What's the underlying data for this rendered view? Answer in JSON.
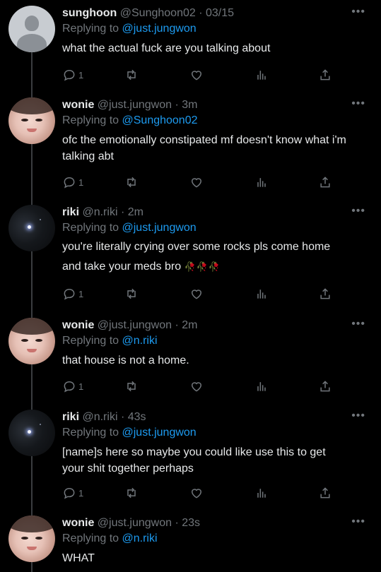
{
  "tweets": [
    {
      "name": "sunghoon",
      "handle": "@Sunghoon02",
      "sep": "·",
      "time": "03/15",
      "reply_prefix": "Replying to",
      "reply_to": "@just.jungwon",
      "text": "what the actual fuck are you talking about",
      "reply_count": "1",
      "avatar": "default-avatar-icon"
    },
    {
      "name": "wonie",
      "handle": "@just.jungwon",
      "sep": "·",
      "time": "3m",
      "reply_prefix": "Replying to",
      "reply_to": "@Sunghoon02",
      "text": "ofc the emotionally constipated mf doesn't know what i'm talking abt",
      "reply_count": "1",
      "avatar": "wonie-avatar"
    },
    {
      "name": "riki",
      "handle": "@n.riki",
      "sep": "·",
      "time": "2m",
      "reply_prefix": "Replying to",
      "reply_to": "@just.jungwon",
      "text": "you're literally crying over some rocks pls come home and take your meds bro",
      "emoji": "🥀🥀🥀",
      "reply_count": "1",
      "avatar": "riki-avatar"
    },
    {
      "name": "wonie",
      "handle": "@just.jungwon",
      "sep": "·",
      "time": "2m",
      "reply_prefix": "Replying to",
      "reply_to": "@n.riki",
      "text": "that house is not a home.",
      "reply_count": "1",
      "avatar": "wonie-avatar"
    },
    {
      "name": "riki",
      "handle": "@n.riki",
      "sep": "·",
      "time": "43s",
      "reply_prefix": "Replying to",
      "reply_to": "@just.jungwon",
      "text": "[name]s here so maybe you could like use this to get your shit together perhaps",
      "reply_count": "1",
      "avatar": "riki-avatar"
    },
    {
      "name": "wonie",
      "handle": "@just.jungwon",
      "sep": "·",
      "time": "23s",
      "reply_prefix": "Replying to",
      "reply_to": "@n.riki",
      "text": "WHAT",
      "avatar": "wonie-avatar"
    }
  ],
  "colors": {
    "background": "#000000",
    "text": "#e7e9ea",
    "muted": "#71767b",
    "link": "#1d9bf0",
    "thread_line": "#3a3d40"
  },
  "icons": {
    "more": "ellipsis-icon",
    "reply": "reply-bubble-icon",
    "retweet": "retweet-icon",
    "like": "heart-icon",
    "views": "views-bar-chart-icon",
    "share": "share-upload-icon"
  }
}
